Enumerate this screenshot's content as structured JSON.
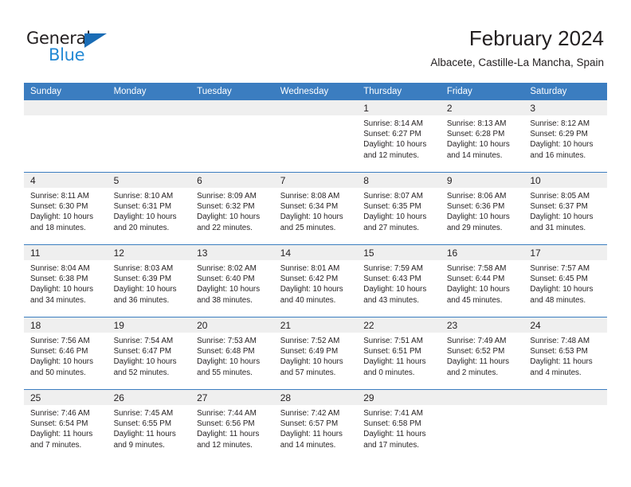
{
  "brand": {
    "name_part1": "General",
    "name_part2": "Blue",
    "accent_color": "#2389d4",
    "triangle_color": "#1a6cb5"
  },
  "header": {
    "title": "February 2024",
    "location": "Albacete, Castille-La Mancha, Spain"
  },
  "theme": {
    "header_row_color": "#3b7dc0",
    "daynum_band_color": "#efefef",
    "text_color": "#231f20"
  },
  "weekday_headers": [
    "Sunday",
    "Monday",
    "Tuesday",
    "Wednesday",
    "Thursday",
    "Friday",
    "Saturday"
  ],
  "weeks": [
    [
      {
        "day": "",
        "sunrise": "",
        "sunset": "",
        "daylight_line1": "",
        "daylight_line2": ""
      },
      {
        "day": "",
        "sunrise": "",
        "sunset": "",
        "daylight_line1": "",
        "daylight_line2": ""
      },
      {
        "day": "",
        "sunrise": "",
        "sunset": "",
        "daylight_line1": "",
        "daylight_line2": ""
      },
      {
        "day": "",
        "sunrise": "",
        "sunset": "",
        "daylight_line1": "",
        "daylight_line2": ""
      },
      {
        "day": "1",
        "sunrise": "Sunrise: 8:14 AM",
        "sunset": "Sunset: 6:27 PM",
        "daylight_line1": "Daylight: 10 hours",
        "daylight_line2": "and 12 minutes."
      },
      {
        "day": "2",
        "sunrise": "Sunrise: 8:13 AM",
        "sunset": "Sunset: 6:28 PM",
        "daylight_line1": "Daylight: 10 hours",
        "daylight_line2": "and 14 minutes."
      },
      {
        "day": "3",
        "sunrise": "Sunrise: 8:12 AM",
        "sunset": "Sunset: 6:29 PM",
        "daylight_line1": "Daylight: 10 hours",
        "daylight_line2": "and 16 minutes."
      }
    ],
    [
      {
        "day": "4",
        "sunrise": "Sunrise: 8:11 AM",
        "sunset": "Sunset: 6:30 PM",
        "daylight_line1": "Daylight: 10 hours",
        "daylight_line2": "and 18 minutes."
      },
      {
        "day": "5",
        "sunrise": "Sunrise: 8:10 AM",
        "sunset": "Sunset: 6:31 PM",
        "daylight_line1": "Daylight: 10 hours",
        "daylight_line2": "and 20 minutes."
      },
      {
        "day": "6",
        "sunrise": "Sunrise: 8:09 AM",
        "sunset": "Sunset: 6:32 PM",
        "daylight_line1": "Daylight: 10 hours",
        "daylight_line2": "and 22 minutes."
      },
      {
        "day": "7",
        "sunrise": "Sunrise: 8:08 AM",
        "sunset": "Sunset: 6:34 PM",
        "daylight_line1": "Daylight: 10 hours",
        "daylight_line2": "and 25 minutes."
      },
      {
        "day": "8",
        "sunrise": "Sunrise: 8:07 AM",
        "sunset": "Sunset: 6:35 PM",
        "daylight_line1": "Daylight: 10 hours",
        "daylight_line2": "and 27 minutes."
      },
      {
        "day": "9",
        "sunrise": "Sunrise: 8:06 AM",
        "sunset": "Sunset: 6:36 PM",
        "daylight_line1": "Daylight: 10 hours",
        "daylight_line2": "and 29 minutes."
      },
      {
        "day": "10",
        "sunrise": "Sunrise: 8:05 AM",
        "sunset": "Sunset: 6:37 PM",
        "daylight_line1": "Daylight: 10 hours",
        "daylight_line2": "and 31 minutes."
      }
    ],
    [
      {
        "day": "11",
        "sunrise": "Sunrise: 8:04 AM",
        "sunset": "Sunset: 6:38 PM",
        "daylight_line1": "Daylight: 10 hours",
        "daylight_line2": "and 34 minutes."
      },
      {
        "day": "12",
        "sunrise": "Sunrise: 8:03 AM",
        "sunset": "Sunset: 6:39 PM",
        "daylight_line1": "Daylight: 10 hours",
        "daylight_line2": "and 36 minutes."
      },
      {
        "day": "13",
        "sunrise": "Sunrise: 8:02 AM",
        "sunset": "Sunset: 6:40 PM",
        "daylight_line1": "Daylight: 10 hours",
        "daylight_line2": "and 38 minutes."
      },
      {
        "day": "14",
        "sunrise": "Sunrise: 8:01 AM",
        "sunset": "Sunset: 6:42 PM",
        "daylight_line1": "Daylight: 10 hours",
        "daylight_line2": "and 40 minutes."
      },
      {
        "day": "15",
        "sunrise": "Sunrise: 7:59 AM",
        "sunset": "Sunset: 6:43 PM",
        "daylight_line1": "Daylight: 10 hours",
        "daylight_line2": "and 43 minutes."
      },
      {
        "day": "16",
        "sunrise": "Sunrise: 7:58 AM",
        "sunset": "Sunset: 6:44 PM",
        "daylight_line1": "Daylight: 10 hours",
        "daylight_line2": "and 45 minutes."
      },
      {
        "day": "17",
        "sunrise": "Sunrise: 7:57 AM",
        "sunset": "Sunset: 6:45 PM",
        "daylight_line1": "Daylight: 10 hours",
        "daylight_line2": "and 48 minutes."
      }
    ],
    [
      {
        "day": "18",
        "sunrise": "Sunrise: 7:56 AM",
        "sunset": "Sunset: 6:46 PM",
        "daylight_line1": "Daylight: 10 hours",
        "daylight_line2": "and 50 minutes."
      },
      {
        "day": "19",
        "sunrise": "Sunrise: 7:54 AM",
        "sunset": "Sunset: 6:47 PM",
        "daylight_line1": "Daylight: 10 hours",
        "daylight_line2": "and 52 minutes."
      },
      {
        "day": "20",
        "sunrise": "Sunrise: 7:53 AM",
        "sunset": "Sunset: 6:48 PM",
        "daylight_line1": "Daylight: 10 hours",
        "daylight_line2": "and 55 minutes."
      },
      {
        "day": "21",
        "sunrise": "Sunrise: 7:52 AM",
        "sunset": "Sunset: 6:49 PM",
        "daylight_line1": "Daylight: 10 hours",
        "daylight_line2": "and 57 minutes."
      },
      {
        "day": "22",
        "sunrise": "Sunrise: 7:51 AM",
        "sunset": "Sunset: 6:51 PM",
        "daylight_line1": "Daylight: 11 hours",
        "daylight_line2": "and 0 minutes."
      },
      {
        "day": "23",
        "sunrise": "Sunrise: 7:49 AM",
        "sunset": "Sunset: 6:52 PM",
        "daylight_line1": "Daylight: 11 hours",
        "daylight_line2": "and 2 minutes."
      },
      {
        "day": "24",
        "sunrise": "Sunrise: 7:48 AM",
        "sunset": "Sunset: 6:53 PM",
        "daylight_line1": "Daylight: 11 hours",
        "daylight_line2": "and 4 minutes."
      }
    ],
    [
      {
        "day": "25",
        "sunrise": "Sunrise: 7:46 AM",
        "sunset": "Sunset: 6:54 PM",
        "daylight_line1": "Daylight: 11 hours",
        "daylight_line2": "and 7 minutes."
      },
      {
        "day": "26",
        "sunrise": "Sunrise: 7:45 AM",
        "sunset": "Sunset: 6:55 PM",
        "daylight_line1": "Daylight: 11 hours",
        "daylight_line2": "and 9 minutes."
      },
      {
        "day": "27",
        "sunrise": "Sunrise: 7:44 AM",
        "sunset": "Sunset: 6:56 PM",
        "daylight_line1": "Daylight: 11 hours",
        "daylight_line2": "and 12 minutes."
      },
      {
        "day": "28",
        "sunrise": "Sunrise: 7:42 AM",
        "sunset": "Sunset: 6:57 PM",
        "daylight_line1": "Daylight: 11 hours",
        "daylight_line2": "and 14 minutes."
      },
      {
        "day": "29",
        "sunrise": "Sunrise: 7:41 AM",
        "sunset": "Sunset: 6:58 PM",
        "daylight_line1": "Daylight: 11 hours",
        "daylight_line2": "and 17 minutes."
      },
      {
        "day": "",
        "sunrise": "",
        "sunset": "",
        "daylight_line1": "",
        "daylight_line2": ""
      },
      {
        "day": "",
        "sunrise": "",
        "sunset": "",
        "daylight_line1": "",
        "daylight_line2": ""
      }
    ]
  ]
}
